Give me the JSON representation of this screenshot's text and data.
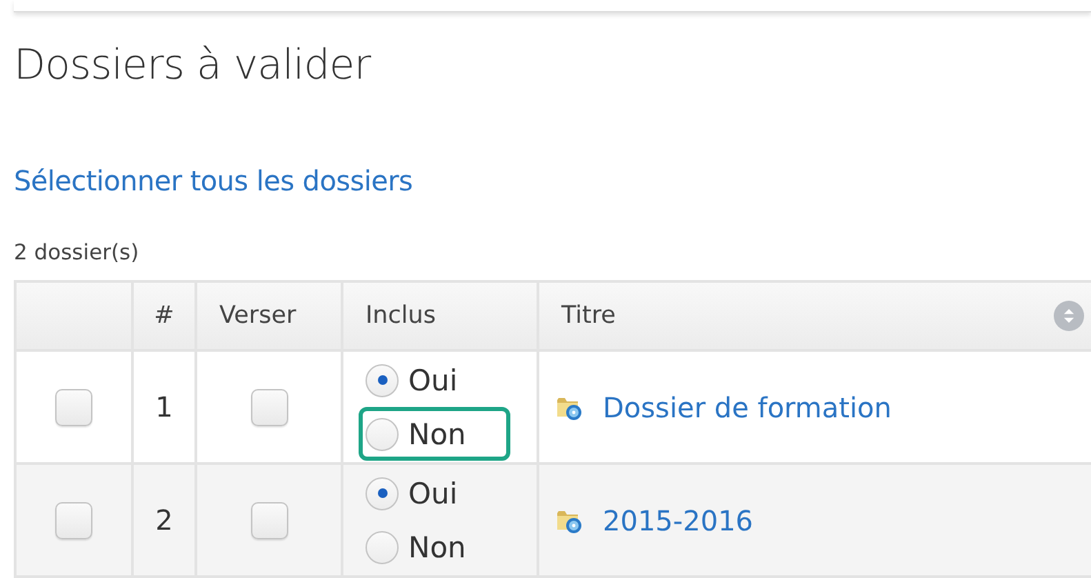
{
  "title": "Dossiers à valider",
  "select_all_link": "Sélectionner tous les dossiers",
  "count": "2 dossier(s)",
  "table": {
    "columns": [
      {
        "sortable": false
      },
      {
        "label": "#",
        "sortable": false
      },
      {
        "label": "Verser",
        "sortable": false
      },
      {
        "label": "Inclus",
        "sortable": false
      },
      {
        "label": "Titre",
        "sortable": true
      }
    ],
    "rows": [
      {
        "checked": false,
        "number": "1",
        "verser": false,
        "inclus": [
          {
            "label": "Oui",
            "selected": true,
            "highlighted": false
          },
          {
            "label": "Non",
            "selected": false,
            "highlighted": true
          }
        ],
        "title": "Dossier de formation"
      },
      {
        "checked": false,
        "number": "2",
        "verser": false,
        "inclus": [
          {
            "label": "Oui",
            "selected": true,
            "highlighted": false
          },
          {
            "label": "Non",
            "selected": false,
            "highlighted": false
          }
        ],
        "title": "2015-2016"
      }
    ]
  }
}
